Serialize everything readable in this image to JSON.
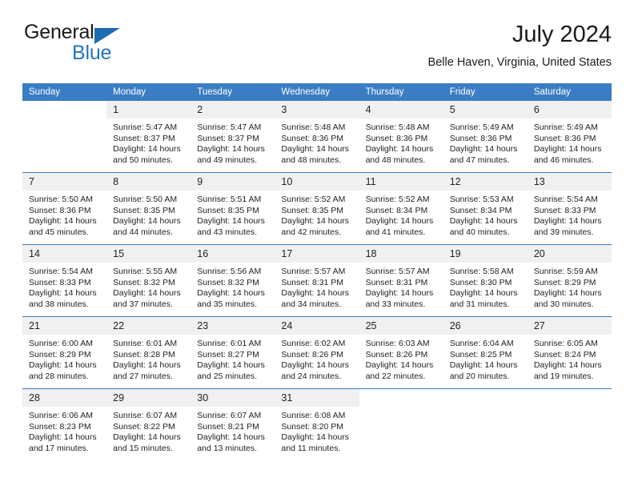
{
  "brand": {
    "name_part1": "General",
    "name_part2": "Blue",
    "triangle_color": "#1d6bb0",
    "blue_text_color": "#2176bd"
  },
  "header": {
    "title": "July 2024",
    "subtitle": "Belle Haven, Virginia, United States",
    "header_bg_color": "#3b7dc4",
    "daynum_bg_color": "#f0f0f0"
  },
  "weekdays": [
    "Sunday",
    "Monday",
    "Tuesday",
    "Wednesday",
    "Thursday",
    "Friday",
    "Saturday"
  ],
  "labels": {
    "sunrise": "Sunrise:",
    "sunset": "Sunset:",
    "daylight": "Daylight:"
  },
  "weeks": [
    [
      {
        "day": "",
        "empty": true,
        "line1": "",
        "line2": "",
        "line3": "",
        "line4": ""
      },
      {
        "day": "1",
        "line1": "Sunrise: 5:47 AM",
        "line2": "Sunset: 8:37 PM",
        "line3": "Daylight: 14 hours",
        "line4": "and 50 minutes."
      },
      {
        "day": "2",
        "line1": "Sunrise: 5:47 AM",
        "line2": "Sunset: 8:37 PM",
        "line3": "Daylight: 14 hours",
        "line4": "and 49 minutes."
      },
      {
        "day": "3",
        "line1": "Sunrise: 5:48 AM",
        "line2": "Sunset: 8:36 PM",
        "line3": "Daylight: 14 hours",
        "line4": "and 48 minutes."
      },
      {
        "day": "4",
        "line1": "Sunrise: 5:48 AM",
        "line2": "Sunset: 8:36 PM",
        "line3": "Daylight: 14 hours",
        "line4": "and 48 minutes."
      },
      {
        "day": "5",
        "line1": "Sunrise: 5:49 AM",
        "line2": "Sunset: 8:36 PM",
        "line3": "Daylight: 14 hours",
        "line4": "and 47 minutes."
      },
      {
        "day": "6",
        "line1": "Sunrise: 5:49 AM",
        "line2": "Sunset: 8:36 PM",
        "line3": "Daylight: 14 hours",
        "line4": "and 46 minutes."
      }
    ],
    [
      {
        "day": "7",
        "line1": "Sunrise: 5:50 AM",
        "line2": "Sunset: 8:36 PM",
        "line3": "Daylight: 14 hours",
        "line4": "and 45 minutes."
      },
      {
        "day": "8",
        "line1": "Sunrise: 5:50 AM",
        "line2": "Sunset: 8:35 PM",
        "line3": "Daylight: 14 hours",
        "line4": "and 44 minutes."
      },
      {
        "day": "9",
        "line1": "Sunrise: 5:51 AM",
        "line2": "Sunset: 8:35 PM",
        "line3": "Daylight: 14 hours",
        "line4": "and 43 minutes."
      },
      {
        "day": "10",
        "line1": "Sunrise: 5:52 AM",
        "line2": "Sunset: 8:35 PM",
        "line3": "Daylight: 14 hours",
        "line4": "and 42 minutes."
      },
      {
        "day": "11",
        "line1": "Sunrise: 5:52 AM",
        "line2": "Sunset: 8:34 PM",
        "line3": "Daylight: 14 hours",
        "line4": "and 41 minutes."
      },
      {
        "day": "12",
        "line1": "Sunrise: 5:53 AM",
        "line2": "Sunset: 8:34 PM",
        "line3": "Daylight: 14 hours",
        "line4": "and 40 minutes."
      },
      {
        "day": "13",
        "line1": "Sunrise: 5:54 AM",
        "line2": "Sunset: 8:33 PM",
        "line3": "Daylight: 14 hours",
        "line4": "and 39 minutes."
      }
    ],
    [
      {
        "day": "14",
        "line1": "Sunrise: 5:54 AM",
        "line2": "Sunset: 8:33 PM",
        "line3": "Daylight: 14 hours",
        "line4": "and 38 minutes."
      },
      {
        "day": "15",
        "line1": "Sunrise: 5:55 AM",
        "line2": "Sunset: 8:32 PM",
        "line3": "Daylight: 14 hours",
        "line4": "and 37 minutes."
      },
      {
        "day": "16",
        "line1": "Sunrise: 5:56 AM",
        "line2": "Sunset: 8:32 PM",
        "line3": "Daylight: 14 hours",
        "line4": "and 35 minutes."
      },
      {
        "day": "17",
        "line1": "Sunrise: 5:57 AM",
        "line2": "Sunset: 8:31 PM",
        "line3": "Daylight: 14 hours",
        "line4": "and 34 minutes."
      },
      {
        "day": "18",
        "line1": "Sunrise: 5:57 AM",
        "line2": "Sunset: 8:31 PM",
        "line3": "Daylight: 14 hours",
        "line4": "and 33 minutes."
      },
      {
        "day": "19",
        "line1": "Sunrise: 5:58 AM",
        "line2": "Sunset: 8:30 PM",
        "line3": "Daylight: 14 hours",
        "line4": "and 31 minutes."
      },
      {
        "day": "20",
        "line1": "Sunrise: 5:59 AM",
        "line2": "Sunset: 8:29 PM",
        "line3": "Daylight: 14 hours",
        "line4": "and 30 minutes."
      }
    ],
    [
      {
        "day": "21",
        "line1": "Sunrise: 6:00 AM",
        "line2": "Sunset: 8:29 PM",
        "line3": "Daylight: 14 hours",
        "line4": "and 28 minutes."
      },
      {
        "day": "22",
        "line1": "Sunrise: 6:01 AM",
        "line2": "Sunset: 8:28 PM",
        "line3": "Daylight: 14 hours",
        "line4": "and 27 minutes."
      },
      {
        "day": "23",
        "line1": "Sunrise: 6:01 AM",
        "line2": "Sunset: 8:27 PM",
        "line3": "Daylight: 14 hours",
        "line4": "and 25 minutes."
      },
      {
        "day": "24",
        "line1": "Sunrise: 6:02 AM",
        "line2": "Sunset: 8:26 PM",
        "line3": "Daylight: 14 hours",
        "line4": "and 24 minutes."
      },
      {
        "day": "25",
        "line1": "Sunrise: 6:03 AM",
        "line2": "Sunset: 8:26 PM",
        "line3": "Daylight: 14 hours",
        "line4": "and 22 minutes."
      },
      {
        "day": "26",
        "line1": "Sunrise: 6:04 AM",
        "line2": "Sunset: 8:25 PM",
        "line3": "Daylight: 14 hours",
        "line4": "and 20 minutes."
      },
      {
        "day": "27",
        "line1": "Sunrise: 6:05 AM",
        "line2": "Sunset: 8:24 PM",
        "line3": "Daylight: 14 hours",
        "line4": "and 19 minutes."
      }
    ],
    [
      {
        "day": "28",
        "line1": "Sunrise: 6:06 AM",
        "line2": "Sunset: 8:23 PM",
        "line3": "Daylight: 14 hours",
        "line4": "and 17 minutes."
      },
      {
        "day": "29",
        "line1": "Sunrise: 6:07 AM",
        "line2": "Sunset: 8:22 PM",
        "line3": "Daylight: 14 hours",
        "line4": "and 15 minutes."
      },
      {
        "day": "30",
        "line1": "Sunrise: 6:07 AM",
        "line2": "Sunset: 8:21 PM",
        "line3": "Daylight: 14 hours",
        "line4": "and 13 minutes."
      },
      {
        "day": "31",
        "line1": "Sunrise: 6:08 AM",
        "line2": "Sunset: 8:20 PM",
        "line3": "Daylight: 14 hours",
        "line4": "and 11 minutes."
      },
      {
        "day": "",
        "empty": true,
        "line1": "",
        "line2": "",
        "line3": "",
        "line4": ""
      },
      {
        "day": "",
        "empty": true,
        "line1": "",
        "line2": "",
        "line3": "",
        "line4": ""
      },
      {
        "day": "",
        "empty": true,
        "line1": "",
        "line2": "",
        "line3": "",
        "line4": ""
      }
    ]
  ]
}
